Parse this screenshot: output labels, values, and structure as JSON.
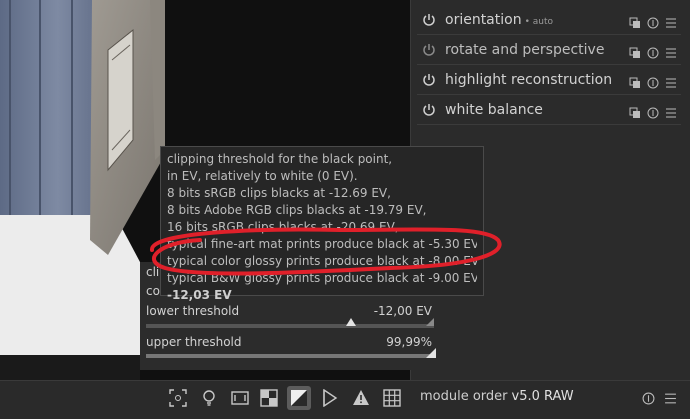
{
  "modules": [
    {
      "name": "orientation",
      "sub": "• auto"
    },
    {
      "name": "rotate and perspective",
      "sub": ""
    },
    {
      "name": "highlight reconstruction",
      "sub": ""
    },
    {
      "name": "white balance",
      "sub": ""
    }
  ],
  "black_point": {
    "cut_labels": [
      "cli",
      "co"
    ],
    "lower_label": "lower threshold",
    "lower_value": "-12,00 EV",
    "upper_label": "upper threshold",
    "upper_value": "99,99%"
  },
  "tooltip": {
    "lines": [
      "clipping threshold for the black point,",
      "in EV, relatively to white (0 EV).",
      "8 bits sRGB clips blacks at -12.69 EV,",
      "8 bits Adobe RGB clips blacks at -19.79 EV,",
      "16 bits sRGB clips blacks at -20.69 EV,",
      "typical fine-art mat prints produce black at -5.30 EV,",
      "typical color glossy prints produce black at -8.00 EV,",
      "typical B&W glossy prints produce black at -9.00 EV"
    ],
    "value": "-12,03 EV"
  },
  "toolbar": {
    "module_order_label": "module order",
    "module_order_value": "v5.0 RAW"
  },
  "icons": [
    "power-icon",
    "multi-instance-icon",
    "reset-icon",
    "presets-icon",
    "focus-peaking-icon",
    "color-assessment-icon",
    "raw-overexposed-icon",
    "clipping-icon",
    "softproof-icon",
    "gamut-check-icon",
    "guides-icon"
  ],
  "colors": {
    "annotation": "#e0202a",
    "active_button": "#5c5c5c"
  }
}
